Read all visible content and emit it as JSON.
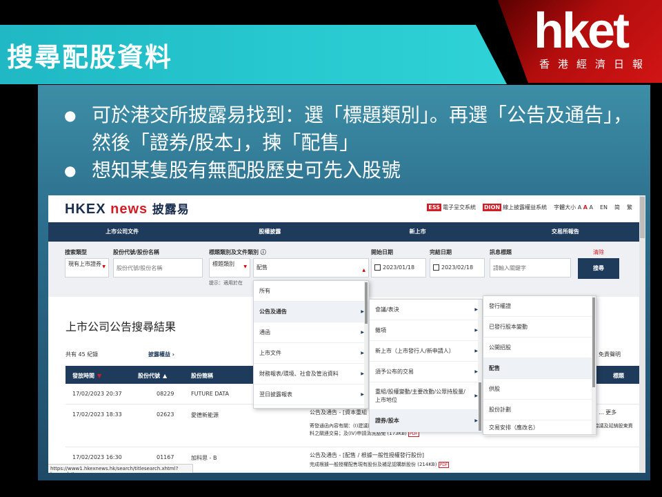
{
  "slide": {
    "title": "搜尋配股資料",
    "logo_brand": "hket",
    "logo_sub": "香港經濟日報",
    "bullets": [
      "可於港交所披露易找到：選「標題類別」。再選「公告及通告」，然後「證券/股本」，揀「配售」",
      "想知某隻股有無配股歷史可先入股號"
    ]
  },
  "hkex": {
    "logo_main": "HKEX",
    "logo_news": "news",
    "logo_dis": "披露易",
    "links": {
      "ess_tag": "ESS",
      "ess_label": "電子呈交系統",
      "dion_tag": "DION",
      "dion_label": "線上披露權益系統",
      "font_size_label": "字體大小",
      "font_a1": "A",
      "font_a2": "A",
      "font_a3": "A",
      "lang_en": "EN",
      "lang_sc": "简",
      "lang_tc": "繁"
    },
    "nav": [
      "上市公司文件",
      "股權披露",
      "新上市",
      "交易所報告"
    ],
    "search": {
      "type_label": "搜索類型",
      "type_value": "現有上市證券",
      "stock_label": "股份代號/股份名稱",
      "stock_placeholder": "股份代號/股份名稱",
      "category_label": "標題類別及文件類別",
      "category_value": "標題類別",
      "doc_type_value": "配售",
      "start_label": "開始日期",
      "start_value": "2023/01/18",
      "end_label": "完結日期",
      "end_value": "2023/02/18",
      "headline_label": "訊息標題",
      "headline_placeholder": "請輸入關鍵字",
      "clear_label": "清除",
      "search_button": "搜尋",
      "hint": "提示：適用於在"
    },
    "results": {
      "title": "上市公司公告搜尋結果",
      "count": "共有 45 紀錄",
      "disclosure_link": "披露權益 ›",
      "right_text": "免責聲明",
      "columns": [
        "發放時間",
        "股份代號",
        "股份簡稱",
        "標題"
      ],
      "rows": [
        {
          "time": "17/02/2023 20:37",
          "code": "08229",
          "name": "FUTURE DATA",
          "headline": ""
        },
        {
          "time": "17/02/2023 18:33",
          "code": "02623",
          "name": "愛德新能源",
          "headline": "公告及通告 - [資本重組",
          "detail": "寄發通函內容有關：(I)建議股份合併；(II)建議按記錄日期每持有三(3)股合併股份獲發一(1)股供股股份之基準進行供股；(III)有關包銷協議及延納股東資料之關連交易；及(IV)申請清洗豁免 (173KB)",
          "more": "... 更多",
          "badge": "PDF"
        },
        {
          "time": "17/02/2023 16:30",
          "code": "01167",
          "name": "加科思 - B",
          "headline": "公告及通告 - [配售 / 根據一般性授權發行股份]",
          "detail": "完成根據一般授權配售現有股份及補足認購新股份 (214KB)",
          "badge": "PDF"
        }
      ]
    },
    "menus": {
      "level1": [
        "所有",
        "公告及通告",
        "通函",
        "上市文件",
        "財務報表/環境、社會及管治資料",
        "翌日披露報表"
      ],
      "level2": [
        "會議/表決",
        "雜項",
        "新上市（上市發行人/新申請人）",
        "須予公布的交易",
        "重組/股權變動/主要改動/公眾持股量/上市地位",
        "證券/股本"
      ],
      "level3": [
        "發行權證",
        "已發行股本變動",
        "公開招股",
        "配售",
        "供股",
        "股份計劃",
        "交易安排（應改名）"
      ]
    },
    "status_url": "https://www1.hkexnews.hk/search/titlesearch.xhtml?lang=zh#"
  }
}
